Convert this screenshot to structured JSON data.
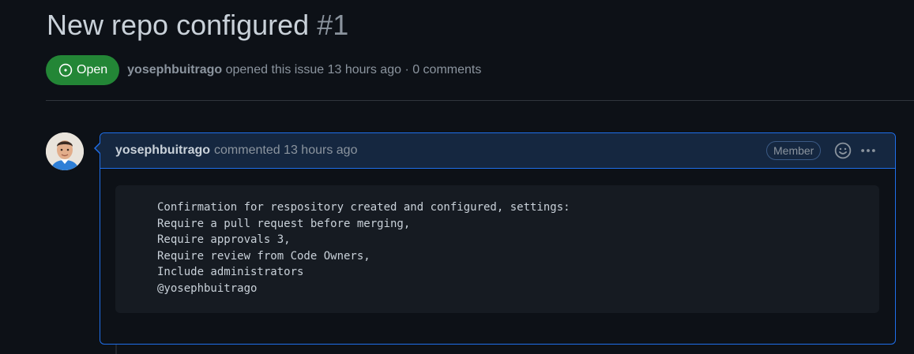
{
  "issue": {
    "title": "New repo configured",
    "number": "#1",
    "state_label": "Open",
    "author": "yosephbuitrago",
    "meta_text": "opened this issue 13 hours ago · 0 comments"
  },
  "comment": {
    "author": "yosephbuitrago",
    "action": "commented 13 hours ago",
    "role_badge": "Member",
    "body_lines": [
      "Confirmation for respository created and configured, settings:",
      "Require a pull request before merging,",
      "Require approvals 3,",
      "Require review from Code Owners,",
      "Include administrators",
      "@yosephbuitrago"
    ]
  },
  "icons": {
    "state": "issue-opened-icon",
    "reaction": "smiley-icon",
    "more": "kebab-horizontal-icon"
  },
  "colors": {
    "background": "#0d1117",
    "open_green": "#238636",
    "accent_blue": "#1f6feb",
    "header_bg": "#152740",
    "code_bg": "#161b22"
  }
}
